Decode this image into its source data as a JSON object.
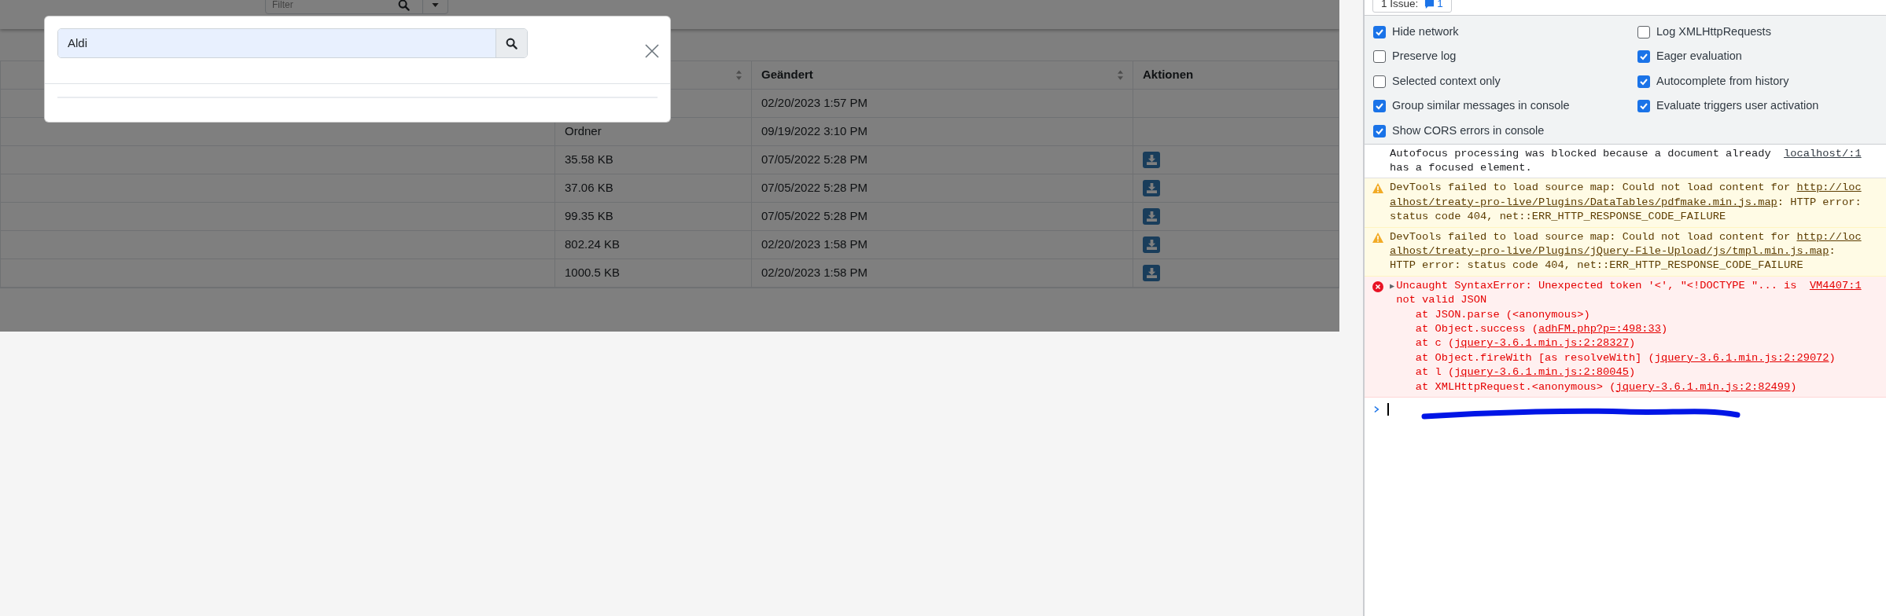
{
  "top_bar": {
    "filter": {
      "placeholder": "Filter"
    }
  },
  "modal": {
    "search": {
      "value": "Aldi"
    }
  },
  "table": {
    "columns": [
      {
        "sortable": true
      },
      {
        "label": "Geändert",
        "sortable": true
      },
      {
        "label": "Aktionen",
        "sortable": false
      }
    ],
    "rows": [
      {
        "modified": "02/20/2023 1:57 PM",
        "download": false
      },
      {
        "size": "Ordner",
        "modified": "09/19/2022 3:10 PM",
        "download": false
      },
      {
        "size": "35.58 KB",
        "modified": "07/05/2022 5:28 PM",
        "download": true
      },
      {
        "size": "37.06 KB",
        "modified": "07/05/2022 5:28 PM",
        "download": true
      },
      {
        "size": "99.35 KB",
        "modified": "07/05/2022 5:28 PM",
        "download": true
      },
      {
        "size": "802.24 KB",
        "modified": "02/20/2023 1:58 PM",
        "download": true
      },
      {
        "size": "1000.5 KB",
        "modified": "02/20/2023 1:58 PM",
        "download": true
      }
    ]
  },
  "devtools": {
    "issues_button": {
      "label": "1 Issue:",
      "count": "1"
    },
    "settings": [
      {
        "label": "Hide network",
        "checked": true
      },
      {
        "label": "Log XMLHttpRequests",
        "checked": false
      },
      {
        "label": "Preserve log",
        "checked": false
      },
      {
        "label": "Eager evaluation",
        "checked": true
      },
      {
        "label": "Selected context only",
        "checked": false
      },
      {
        "label": "Autocomplete from history",
        "checked": true
      },
      {
        "label": "Group similar messages in console",
        "checked": true
      },
      {
        "label": "Evaluate triggers user activation",
        "checked": true
      },
      {
        "label": "Show CORS errors in console",
        "checked": true
      }
    ],
    "console": {
      "messages": [
        {
          "kind": "info",
          "source": "localhost/:1",
          "parts": [
            {
              "text": "Autofocus processing was blocked because a document already has a focused element."
            }
          ]
        },
        {
          "kind": "warning",
          "parts": [
            {
              "text": "DevTools failed to load source map: Could not load content for "
            },
            {
              "text": "http://loc",
              "link": true
            },
            {
              "text": "alhost/treaty-pro-live/Plugins/DataTables/pdfmake.min.js.map",
              "link": true
            },
            {
              "text": ": HTTP error: status code 404, net::ERR_HTTP_RESPONSE_CODE_FAILURE"
            }
          ]
        },
        {
          "kind": "warning",
          "parts": [
            {
              "text": "DevTools failed to load source map: Could not load content for "
            },
            {
              "text": "http://loc",
              "link": true
            },
            {
              "text": "alhost/treaty-pro-live/Plugins/jQuery-File-Upload/js/tmpl.min.js.map",
              "link": true
            },
            {
              "text": ": HTTP error: status code 404, net::ERR_HTTP_RESPONSE_CODE_FAILURE"
            }
          ]
        },
        {
          "kind": "error",
          "toggle": "▶",
          "source": "VM4407:1",
          "parts": [
            {
              "text": "Uncaught SyntaxError: Unexpected token '<', \"<!DOCTYPE \"... is not valid JSON"
            }
          ],
          "stack": [
            [
              {
                "text": "at JSON.parse (<anonymous>)"
              }
            ],
            [
              {
                "text": "at Object.success ("
              },
              {
                "text": "adhFM.php?p=:498:33",
                "link": true
              },
              {
                "text": ")"
              }
            ],
            [
              {
                "text": "at c ("
              },
              {
                "text": "jquery-3.6.1.min.js:2:28327",
                "link": true
              },
              {
                "text": ")"
              }
            ],
            [
              {
                "text": "at Object.fireWith [as resolveWith] ("
              },
              {
                "text": "jquery-3.6.1.min.js:2:29072",
                "link": true
              },
              {
                "text": ")"
              }
            ],
            [
              {
                "text": "at l ("
              },
              {
                "text": "jquery-3.6.1.min.js:2:80045",
                "link": true
              },
              {
                "text": ")"
              }
            ],
            [
              {
                "text": "at XMLHttpRequest.<anonymous> ("
              },
              {
                "text": "jquery-3.6.1.min.js:2:82499",
                "link": true
              },
              {
                "text": ")"
              }
            ]
          ]
        }
      ]
    }
  }
}
